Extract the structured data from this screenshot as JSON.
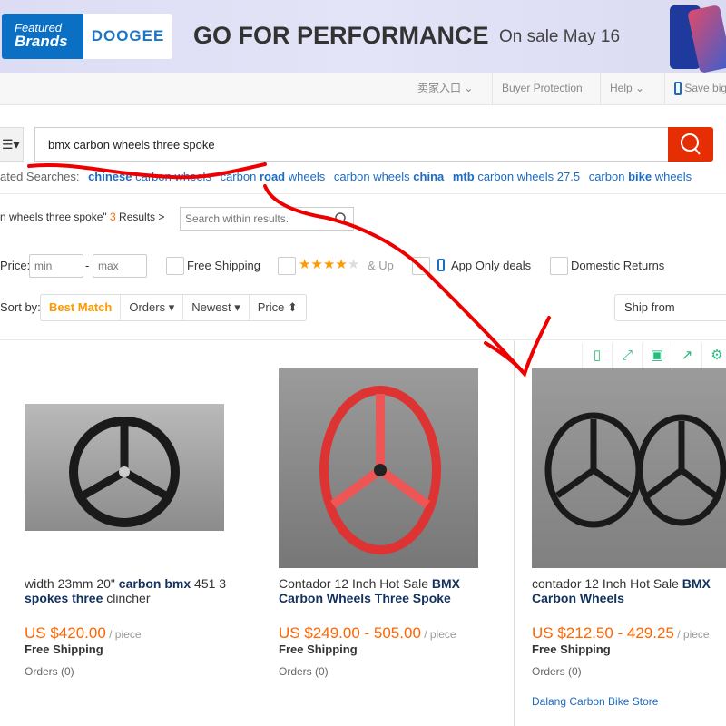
{
  "banner": {
    "featured_top": "Featured",
    "featured_bottom": "Brands",
    "brand_logo": "DOOGEE",
    "slogan": "GO FOR PERFORMANCE",
    "sale": "On sale May 16"
  },
  "nav": {
    "seller": "卖家入口",
    "buyer_protection": "Buyer Protection",
    "help": "Help",
    "save": "Save big"
  },
  "search": {
    "value": "bmx carbon wheels three spoke",
    "button_icon": "search-icon",
    "accent": "#e62e04"
  },
  "related": {
    "label": "ated Searches:",
    "items": [
      {
        "pre": "",
        "bold": "chinese",
        "post": " carbon wheels"
      },
      {
        "pre": "carbon ",
        "bold": "road",
        "post": " wheels"
      },
      {
        "pre": "carbon wheels ",
        "bold": "china",
        "post": ""
      },
      {
        "pre": "",
        "bold": "mtb",
        "post": " carbon wheels 27.5"
      },
      {
        "pre": "carbon ",
        "bold": "bike",
        "post": " wheels"
      }
    ]
  },
  "results": {
    "query_tail": "n wheels three spoke\"",
    "count": "3",
    "suffix": " Results >",
    "within_placeholder": "Search within results."
  },
  "filters": {
    "price_label": "Price:",
    "min": "min",
    "dash": "-",
    "max": "max",
    "free_shipping": "Free Shipping",
    "rating_suffix": "& Up",
    "rating": 4,
    "app_only": "App Only deals",
    "domestic": "Domestic Returns"
  },
  "sort": {
    "label": "Sort by:",
    "options": [
      "Best Match",
      "Orders",
      "Newest",
      "Price"
    ],
    "active": "Best Match",
    "ship_from": "Ship from"
  },
  "tools": [
    "tablet-icon",
    "expand-icon",
    "save-icon",
    "share-icon",
    "gear-icon"
  ],
  "products": [
    {
      "title_parts": [
        [
          "width 23mm 20\" ",
          ""
        ],
        [
          "carbon bmx",
          "b"
        ],
        [
          " 451 3 ",
          ""
        ],
        [
          "spokes three",
          "b"
        ],
        [
          " clincher",
          ""
        ]
      ],
      "price": "US $420.00",
      "unit": " / piece",
      "shipping": "Free Shipping",
      "orders": "Orders (0)"
    },
    {
      "title_parts": [
        [
          "Contador 12 Inch Hot Sale ",
          ""
        ],
        [
          "BMX Carbon Wheels Three Spoke",
          "b"
        ]
      ],
      "price": "US $249.00 - 505.00",
      "unit": " / piece",
      "shipping": "Free Shipping",
      "orders": "Orders (0)"
    },
    {
      "title_parts": [
        [
          "contador 12 Inch Hot Sale ",
          ""
        ],
        [
          "BMX Carbon Wheels",
          "b"
        ]
      ],
      "price": "US $212.50 - 429.25",
      "unit": " / piece",
      "shipping": "Free Shipping",
      "orders": "Orders (0)",
      "store": "Dalang Carbon Bike Store"
    }
  ]
}
